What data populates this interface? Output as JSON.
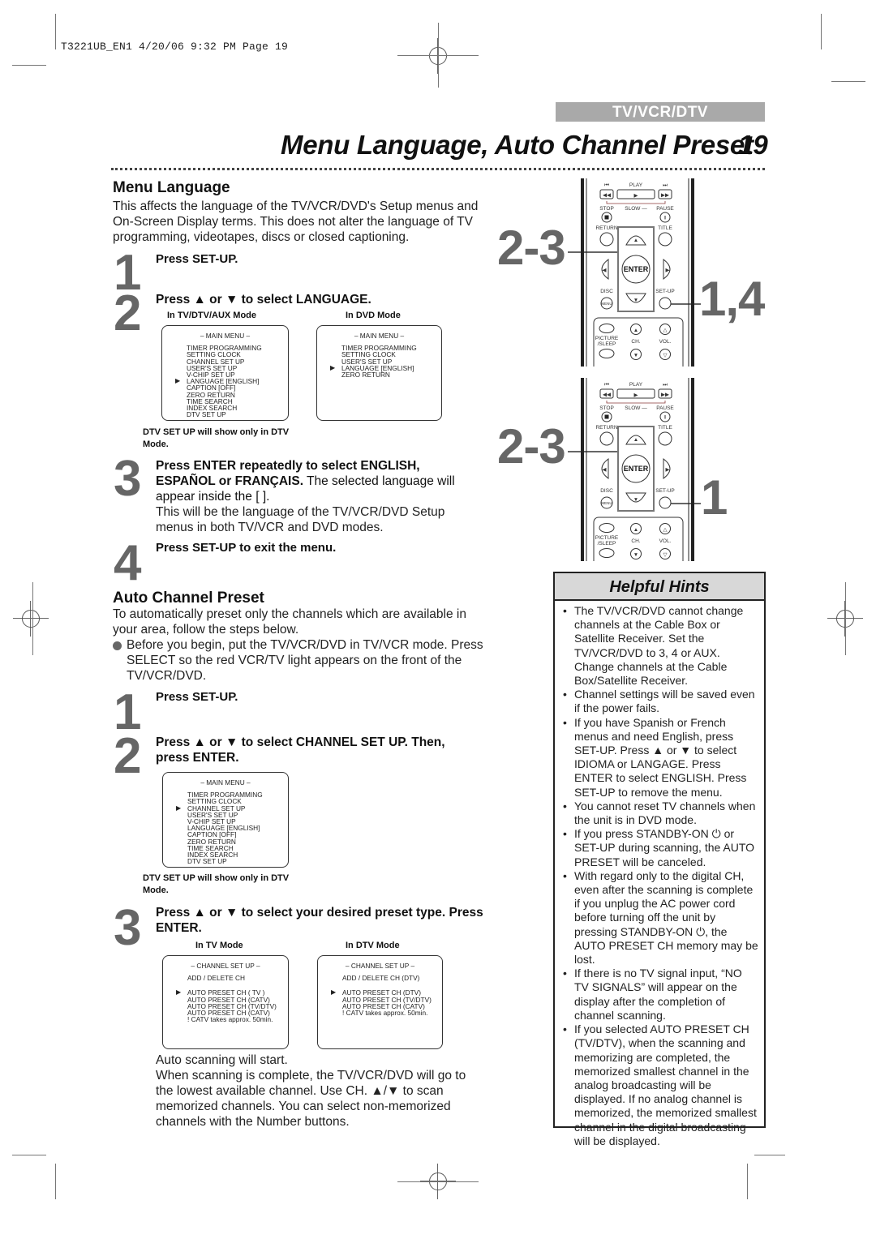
{
  "print_slug": "T3221UB_EN1  4/20/06  9:32 PM  Page 19",
  "header": {
    "section_tag": "TV/VCR/DTV",
    "title": "Menu Language, Auto Channel Preset",
    "page_number": "19"
  },
  "menu_language": {
    "heading": "Menu Language",
    "intro": "This affects the language of the TV/VCR/DVD's Setup menus and On-Screen Display terms. This does not alter the language of TV programming, videotapes, discs or closed captioning.",
    "steps": [
      {
        "num": "1",
        "text": "Press SET-UP."
      },
      {
        "num": "2",
        "text": "Press ▲ or ▼ to select LANGUAGE."
      },
      {
        "num": "3",
        "bold": "Press ENTER repeatedly to select ENGLISH, ESPAÑOL or FRANÇAIS.",
        "normal": " The selected language will appear inside the [ ].",
        "extra": "This will be the language of the TV/VCR/DVD Setup menus in both TV/VCR and DVD modes."
      },
      {
        "num": "4",
        "text": "Press SET-UP to exit the menu."
      }
    ],
    "screens": [
      {
        "mode_label": "In TV/DTV/AUX Mode",
        "title": "– MAIN MENU –",
        "items": [
          "TIMER PROGRAMMING",
          "SETTING CLOCK",
          "CHANNEL SET UP",
          "USER'S SET UP",
          "V-CHIP SET UP",
          "LANGUAGE  [ENGLISH]",
          "CAPTION  [OFF]",
          "ZERO RETURN",
          "TIME SEARCH",
          "INDEX SEARCH",
          "DTV SET UP"
        ],
        "selected_index": 5
      },
      {
        "mode_label": "In DVD Mode",
        "title": "– MAIN MENU –",
        "items": [
          "TIMER PROGRAMMING",
          "SETTING CLOCK",
          "USER'S SET UP",
          "LANGUAGE  [ENGLISH]",
          "ZERO RETURN"
        ],
        "selected_index": 3
      }
    ],
    "note": "DTV SET UP will show only in DTV Mode."
  },
  "auto_channel_preset": {
    "heading": "Auto Channel Preset",
    "intro": "To automatically preset only the channels which are available in your area, follow the steps below.",
    "bullet": "Before you begin, put the TV/VCR/DVD in TV/VCR mode. Press SELECT so the red VCR/TV light appears on the front of the TV/VCR/DVD.",
    "steps": [
      {
        "num": "1",
        "text": "Press SET-UP."
      },
      {
        "num": "2",
        "text": "Press ▲ or ▼ to select CHANNEL SET UP. Then, press ENTER."
      },
      {
        "num": "3",
        "text": "Press ▲ or ▼ to select your desired preset type. Press ENTER."
      }
    ],
    "main_menu_screen": {
      "title": "– MAIN MENU –",
      "items": [
        "TIMER PROGRAMMING",
        "SETTING CLOCK",
        "CHANNEL SET UP",
        "USER'S SET UP",
        "V-CHIP SET UP",
        "LANGUAGE  [ENGLISH]",
        "CAPTION  [OFF]",
        "ZERO RETURN",
        "TIME SEARCH",
        "INDEX SEARCH",
        "DTV SET UP"
      ],
      "selected_index": 2
    },
    "note": "DTV SET UP will show only in DTV Mode.",
    "channel_screens": [
      {
        "mode_label": "In TV Mode",
        "title": "– CHANNEL SET UP –",
        "add_delete": "ADD / DELETE CH",
        "items": [
          "AUTO PRESET CH (  TV  )",
          "AUTO PRESET CH (CATV)",
          "AUTO PRESET CH (TV/DTV)",
          "AUTO PRESET CH (CATV)",
          "! CATV takes approx. 50min."
        ],
        "selected_index": 0
      },
      {
        "mode_label": "In DTV Mode",
        "title": "– CHANNEL SET UP –",
        "add_delete": "ADD / DELETE CH (DTV)",
        "items": [
          "AUTO PRESET CH (DTV)",
          "AUTO PRESET CH (TV/DTV)",
          "AUTO PRESET CH (CATV)",
          "! CATV takes approx. 50min."
        ],
        "selected_index": 0
      }
    ],
    "after_1": "Auto scanning will start.",
    "after_2": "When scanning is complete, the TV/VCR/DVD will go to the lowest available channel. Use CH. ▲/▼ to scan memorized channels. You can select non-memorized channels with the Number buttons."
  },
  "remote": {
    "labels": {
      "play": "PLAY",
      "stop": "STOP",
      "slow": "SLOW",
      "pause": "PAUSE",
      "return": "RETURN",
      "title": "TITLE",
      "enter": "ENTER",
      "disc": "DISC",
      "menu": "MENU",
      "setup": "SET-UP",
      "picture": "PICTURE /SLEEP",
      "ch": "CH.",
      "vol": "VOL."
    },
    "callouts_top": {
      "left": "2-3",
      "right": "1,4"
    },
    "callouts_bottom": {
      "left": "2-3",
      "right": "1"
    }
  },
  "helpful_hints": {
    "title": "Helpful Hints",
    "items": [
      "The TV/VCR/DVD cannot change channels at the Cable Box or Satellite Receiver. Set the TV/VCR/DVD to 3, 4 or AUX. Change channels at the Cable Box/Satellite Receiver.",
      "Channel settings will be saved even if the power fails.",
      "If you have Spanish or French menus and need English, press SET-UP. Press ▲ or ▼ to select IDIOMA or LANGAGE. Press ENTER to select ENGLISH. Press SET-UP to remove the menu.",
      "You cannot reset TV channels when the unit is in DVD mode.",
      "If you press STANDBY-ON ⏻ or SET-UP during scanning, the AUTO PRESET will be canceled.",
      "With regard only to the digital CH, even after the scanning is complete if you unplug the AC power cord before turning off the unit by pressing STANDBY-ON ⏻, the AUTO PRESET CH memory may be lost.",
      "If there is no TV signal input, “NO TV SIGNALS” will appear on the display after the completion of channel scanning.",
      "If you selected AUTO PRESET CH (TV/DTV), when the scanning and memorizing are completed, the memorized smallest channel in the analog broadcasting will be displayed. If no analog channel is memorized, the memorized smallest channel in the digital broadcasting will be displayed."
    ]
  }
}
